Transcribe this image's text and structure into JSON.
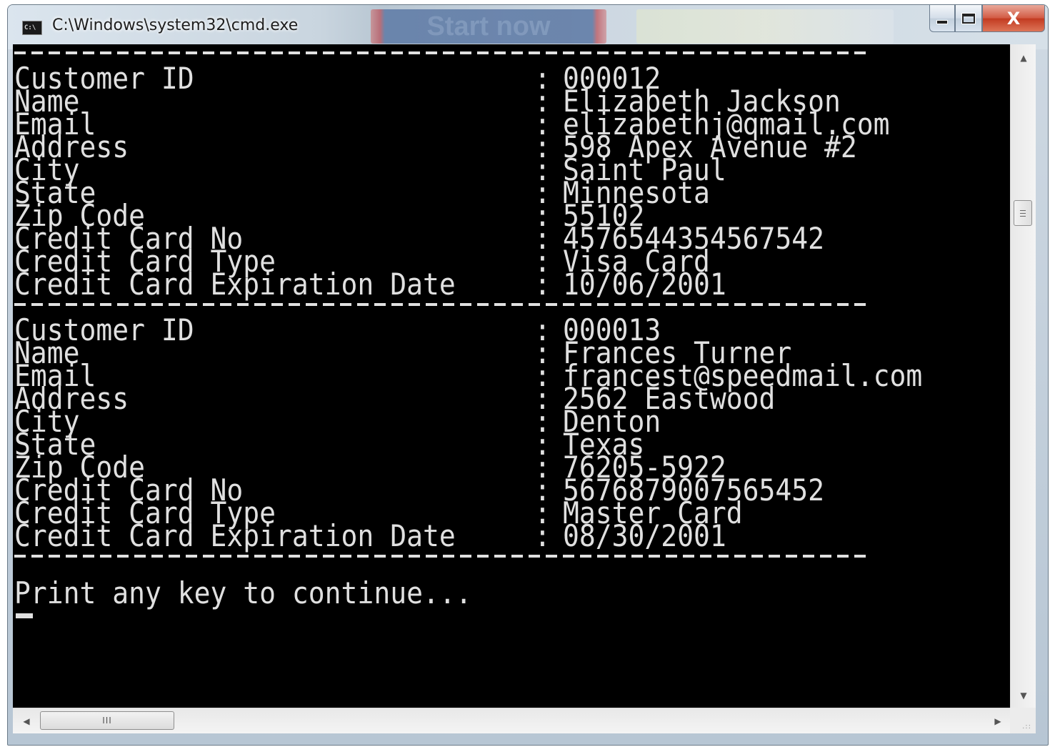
{
  "window": {
    "title": "C:\\Windows\\system32\\cmd.exe",
    "icon_text": "C:\\",
    "background_banner": "Start now",
    "controls": {
      "minimize_icon": "minimize-icon",
      "maximize_icon": "maximize-icon",
      "close_icon": "close-icon",
      "close_glyph": "X"
    }
  },
  "console": {
    "records": [
      {
        "fields": [
          {
            "label": "Customer ID",
            "value": "000012"
          },
          {
            "label": "Name",
            "value": "Elizabeth Jackson"
          },
          {
            "label": "Email",
            "value": "elizabethj@qmail.com"
          },
          {
            "label": "Address",
            "value": "598 Apex Avenue #2"
          },
          {
            "label": "City",
            "value": "Saint Paul"
          },
          {
            "label": "State",
            "value": "Minnesota"
          },
          {
            "label": "Zip Code",
            "value": "55102"
          },
          {
            "label": "Credit Card No",
            "value": "4576544354567542"
          },
          {
            "label": "Credit Card Type",
            "value": "Visa Card"
          },
          {
            "label": "Credit Card Expiration Date",
            "value": "10/06/2001"
          }
        ]
      },
      {
        "fields": [
          {
            "label": "Customer ID",
            "value": "000013"
          },
          {
            "label": "Name",
            "value": "Frances Turner"
          },
          {
            "label": "Email",
            "value": "francest@speedmail.com"
          },
          {
            "label": "Address",
            "value": "2562 Eastwood"
          },
          {
            "label": "City",
            "value": "Denton"
          },
          {
            "label": "State",
            "value": "Texas"
          },
          {
            "label": "Zip Code",
            "value": "76205-5922"
          },
          {
            "label": "Credit Card No",
            "value": "5676879007565452"
          },
          {
            "label": "Credit Card Type",
            "value": "Master Card"
          },
          {
            "label": "Credit Card Expiration Date",
            "value": "08/30/2001"
          }
        ]
      }
    ],
    "separator": ":",
    "prompt": "Print any key to continue..."
  },
  "scrollbars": {
    "vertical": {
      "up_icon": "scroll-up-arrow-icon",
      "down_icon": "scroll-down-arrow-icon"
    },
    "horizontal": {
      "left_icon": "scroll-left-arrow-icon",
      "right_icon": "scroll-right-arrow-icon",
      "thumb_grip": "III"
    }
  }
}
